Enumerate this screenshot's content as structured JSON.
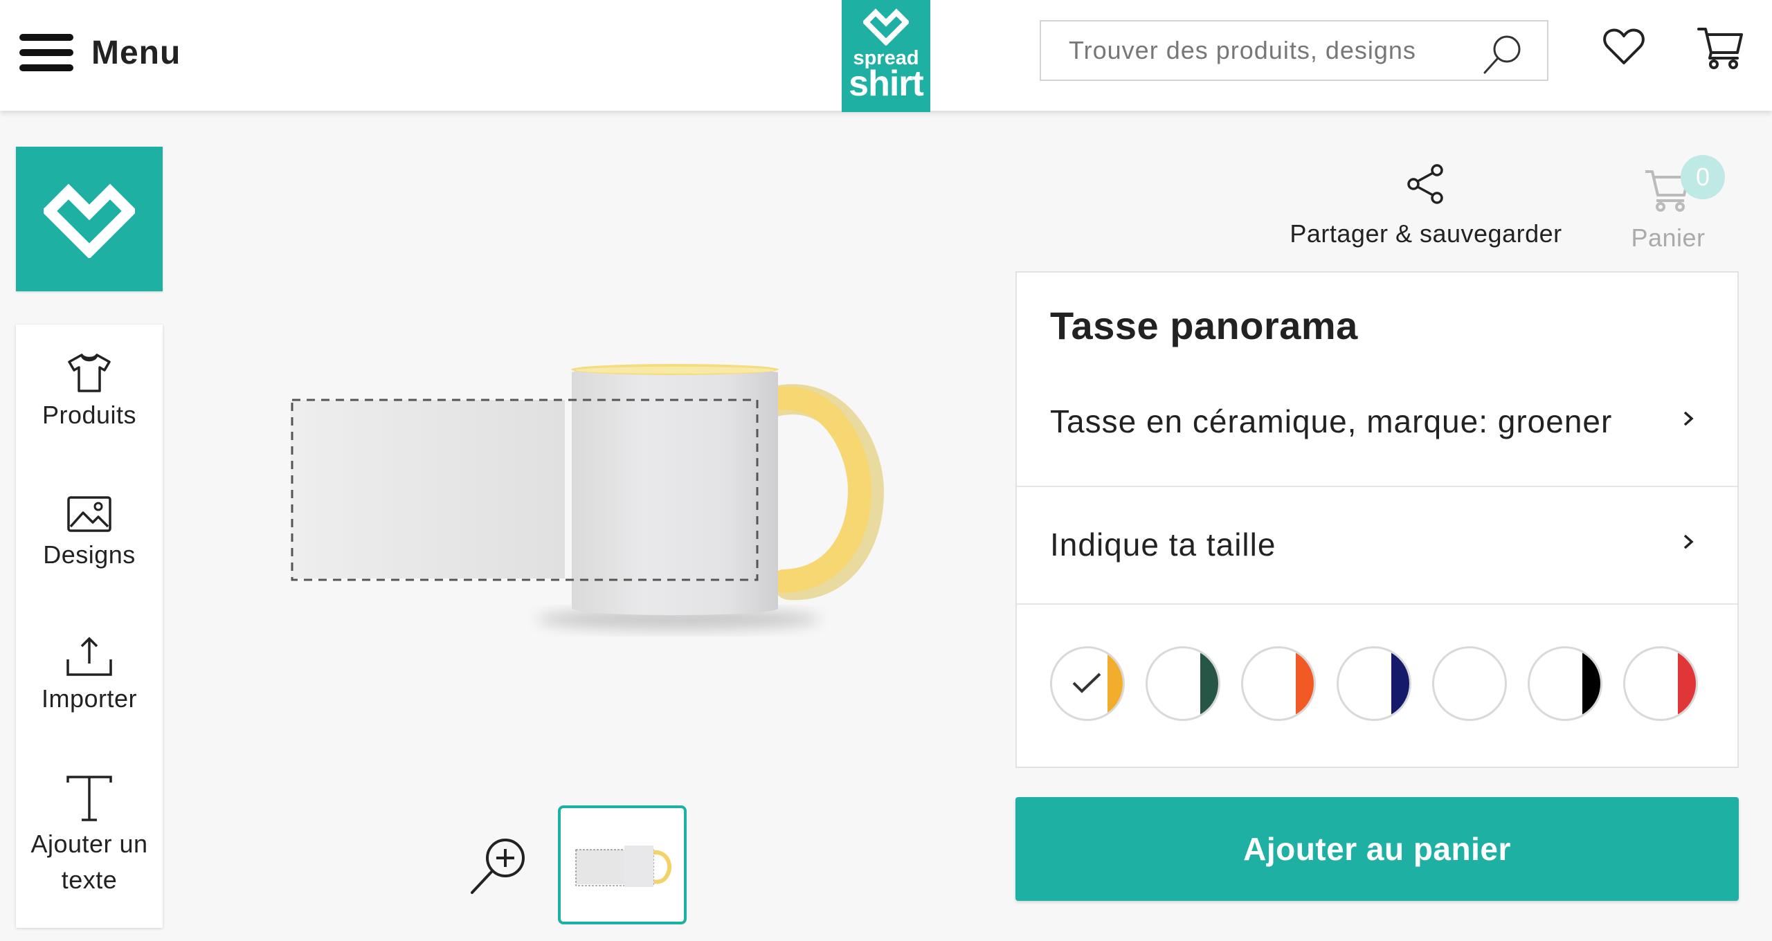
{
  "header": {
    "menu_label": "Menu",
    "logo_line1": "spread",
    "logo_line2": "shirt",
    "search_placeholder": "Trouver des produits, designs"
  },
  "sidebar": {
    "tools": [
      {
        "label": "Produits",
        "icon": "tshirt-icon"
      },
      {
        "label": "Designs",
        "icon": "image-icon"
      },
      {
        "label": "Importer",
        "icon": "upload-icon"
      },
      {
        "label_line1": "Ajouter un",
        "label_line2": "texte",
        "icon": "text-icon"
      }
    ]
  },
  "actions": {
    "share_label": "Partager & sauvegarder",
    "cart_label": "Panier",
    "cart_count": "0"
  },
  "product": {
    "title": "Tasse panorama",
    "material": "Tasse en céramique, marque: groener",
    "size_prompt": "Indique ta taille",
    "colors": [
      {
        "name": "yellow",
        "hex": "#f1ad2b",
        "selected": true
      },
      {
        "name": "dark-green",
        "hex": "#275646",
        "selected": false
      },
      {
        "name": "orange",
        "hex": "#f15a24",
        "selected": false
      },
      {
        "name": "navy",
        "hex": "#151a6b",
        "selected": false
      },
      {
        "name": "white",
        "hex": "#ffffff",
        "selected": false
      },
      {
        "name": "black",
        "hex": "#000000",
        "selected": false
      },
      {
        "name": "red",
        "hex": "#e03638",
        "selected": false
      }
    ],
    "add_to_cart": "Ajouter au panier"
  },
  "colors": {
    "brand": "#1eb1a3",
    "handle": "#f4d368"
  }
}
